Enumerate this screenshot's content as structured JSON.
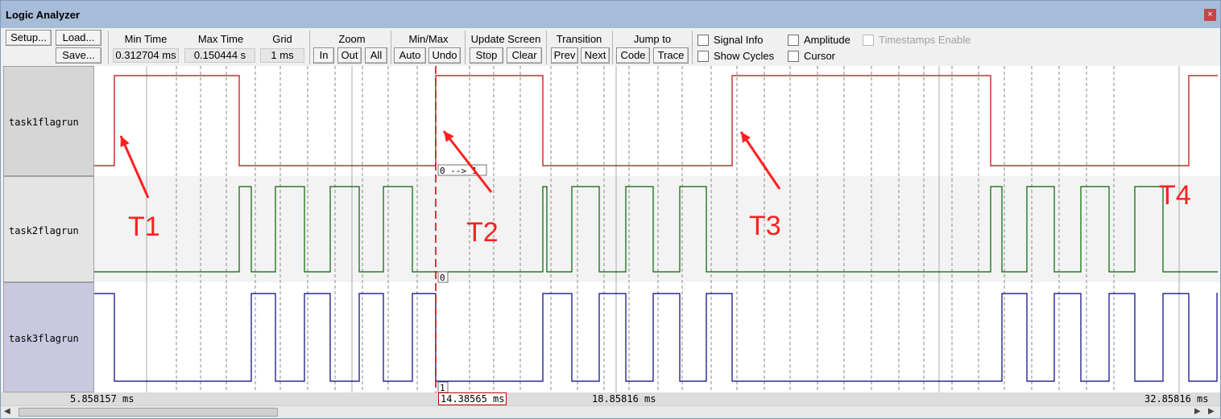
{
  "window": {
    "title": "Logic Analyzer",
    "close": "×"
  },
  "toolbar": {
    "setup": "Setup...",
    "load": "Load...",
    "save": "Save...",
    "min_time_label": "Min Time",
    "min_time_value": "0.312704 ms",
    "max_time_label": "Max Time",
    "max_time_value": "0.150444 s",
    "grid_label": "Grid",
    "grid_value": "1 ms",
    "zoom_label": "Zoom",
    "zoom_in": "In",
    "zoom_out": "Out",
    "zoom_all": "All",
    "minmax_label": "Min/Max",
    "auto": "Auto",
    "undo": "Undo",
    "update_label": "Update Screen",
    "stop": "Stop",
    "clear": "Clear",
    "transition_label": "Transition",
    "prev": "Prev",
    "next": "Next",
    "jump_label": "Jump to",
    "code": "Code",
    "trace": "Trace",
    "signal_info": "Signal Info",
    "amplitude": "Amplitude",
    "timestamps": "Timestamps Enable",
    "show_cycles": "Show Cycles",
    "cursor": "Cursor"
  },
  "signals": [
    {
      "name": "task1flagrun",
      "color": "#c00000",
      "hi": "1",
      "lo": "0",
      "transitions": [
        141,
        296,
        540,
        673,
        908,
        1229,
        1475
      ],
      "start_level": 0,
      "cursor_tag": "0 --> 1"
    },
    {
      "name": "task2flagrun",
      "color": "#006400",
      "hi": "1",
      "lo": "0",
      "transitions": [
        296,
        311,
        341,
        377,
        409,
        445,
        475,
        511,
        673,
        678,
        709,
        743,
        776,
        810,
        843,
        876,
        1229,
        1243,
        1274,
        1308,
        1341,
        1376,
        1408,
        1443
      ],
      "start_level": 0,
      "cursor_tag": "0"
    },
    {
      "name": "task3flagrun",
      "color": "#000080",
      "hi": "1",
      "lo": "0",
      "transitions": [
        141,
        311,
        341,
        377,
        409,
        445,
        475,
        511,
        540,
        673,
        709,
        743,
        776,
        810,
        843,
        876,
        908,
        1243,
        1274,
        1308,
        1341,
        1376,
        1408,
        1443,
        1475,
        1510
      ],
      "start_level": 1,
      "cursor_tag": "1"
    }
  ],
  "time_axis": {
    "left": "5.858157 ms",
    "cursor": "14.38565 ms",
    "mid": "18.85816 ms",
    "right": "32.85816 ms"
  },
  "annotations": [
    "T1",
    "T2",
    "T3",
    "T4"
  ],
  "colors": {
    "annotation": "#ff2020",
    "cursor": "#c00000"
  }
}
